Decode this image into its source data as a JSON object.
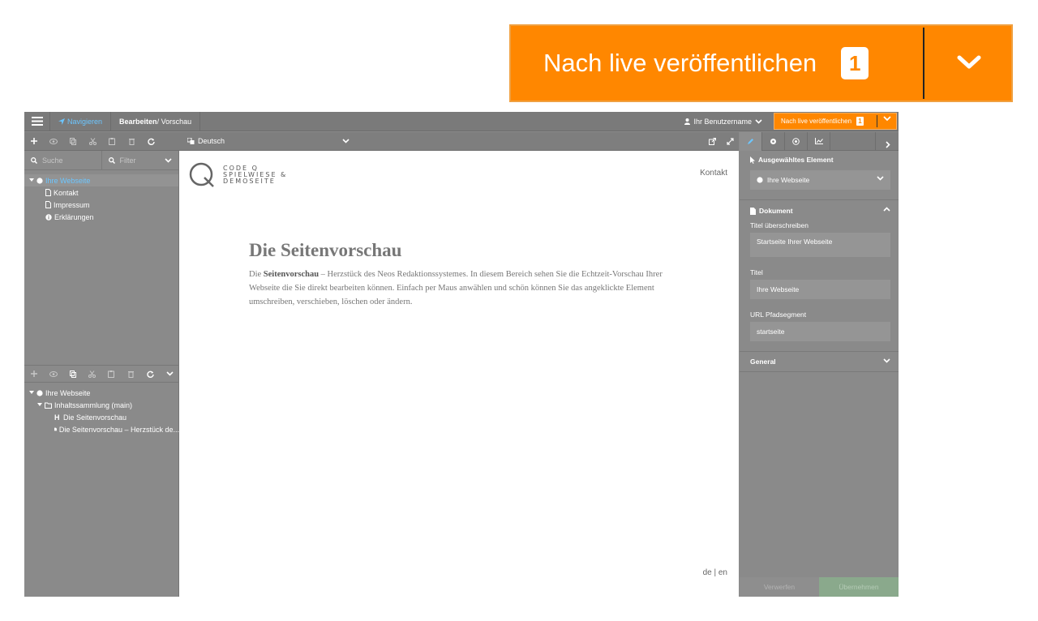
{
  "callout": {
    "label": "Nach live veröffentlichen",
    "badge": "1"
  },
  "topbar": {
    "nav_label": "Navigieren",
    "edit_label": "Bearbeiten",
    "preview_label": " / Vorschau",
    "user": "Ihr Benutzername",
    "publish_label": "Nach live veröffentlichen",
    "publish_badge": "1"
  },
  "toolbar": {
    "language": "Deutsch"
  },
  "left": {
    "search_placeholder": "Suche",
    "filter_label": "Filter",
    "page_tree": [
      {
        "label": "Ihre Webseite",
        "icon": "globe-icon",
        "level": 0,
        "selected": true
      },
      {
        "label": "Kontakt",
        "icon": "page-icon",
        "level": 1
      },
      {
        "label": "Impressum",
        "icon": "page-icon",
        "level": 1
      },
      {
        "label": "Erklärungen",
        "icon": "info-icon",
        "level": 1
      }
    ],
    "content_tree": [
      {
        "label": "Ihre Webseite",
        "icon": "globe-icon",
        "level": 0
      },
      {
        "label": "Inhaltssammlung (main)",
        "icon": "folder-icon",
        "level": 1
      },
      {
        "label": "Die Seitenvorschau",
        "icon": "heading-icon",
        "level": 2
      },
      {
        "label": "Die Seitenvorschau – Herzstück de...",
        "icon": "text-icon",
        "level": 2
      }
    ]
  },
  "content": {
    "logo_line1": "CODE Q",
    "logo_line2": "SPIELWIESE &",
    "logo_line3": "DEMOSEITE",
    "nav_link": "Kontakt",
    "heading": "Die Seitenvorschau",
    "para_prefix": "Die ",
    "para_bold": "Seitenvorschau",
    "para_rest": " – Herzstück des Neos Redaktionssystemes. In diesem Bereich sehen Sie die Echtzeit-Vorschau Ihrer Webseite die Sie direkt bearbeiten können. Einfach per Maus anwählen und schön können Sie das angeklickte Element umschreiben, verschieben, löschen oder ändern.",
    "lang_switch": "de | en"
  },
  "inspector": {
    "selected_heading": "Ausgewähltes Element",
    "selected_value": "Ihre Webseite",
    "doc_heading": "Dokument",
    "field1_label": "Titel überschreiben",
    "field1_value": "Startseite Ihrer Webseite",
    "field2_label": "Titel",
    "field2_value": "Ihre Webseite",
    "field3_label": "URL Pfadsegment",
    "field3_value": "startseite",
    "general_heading": "General",
    "discard": "Verwerfen",
    "apply": "Übernehmen"
  },
  "colors": {
    "accent": "#ff8700",
    "link": "#6cc6ff",
    "panel": "#8a8a8a"
  }
}
